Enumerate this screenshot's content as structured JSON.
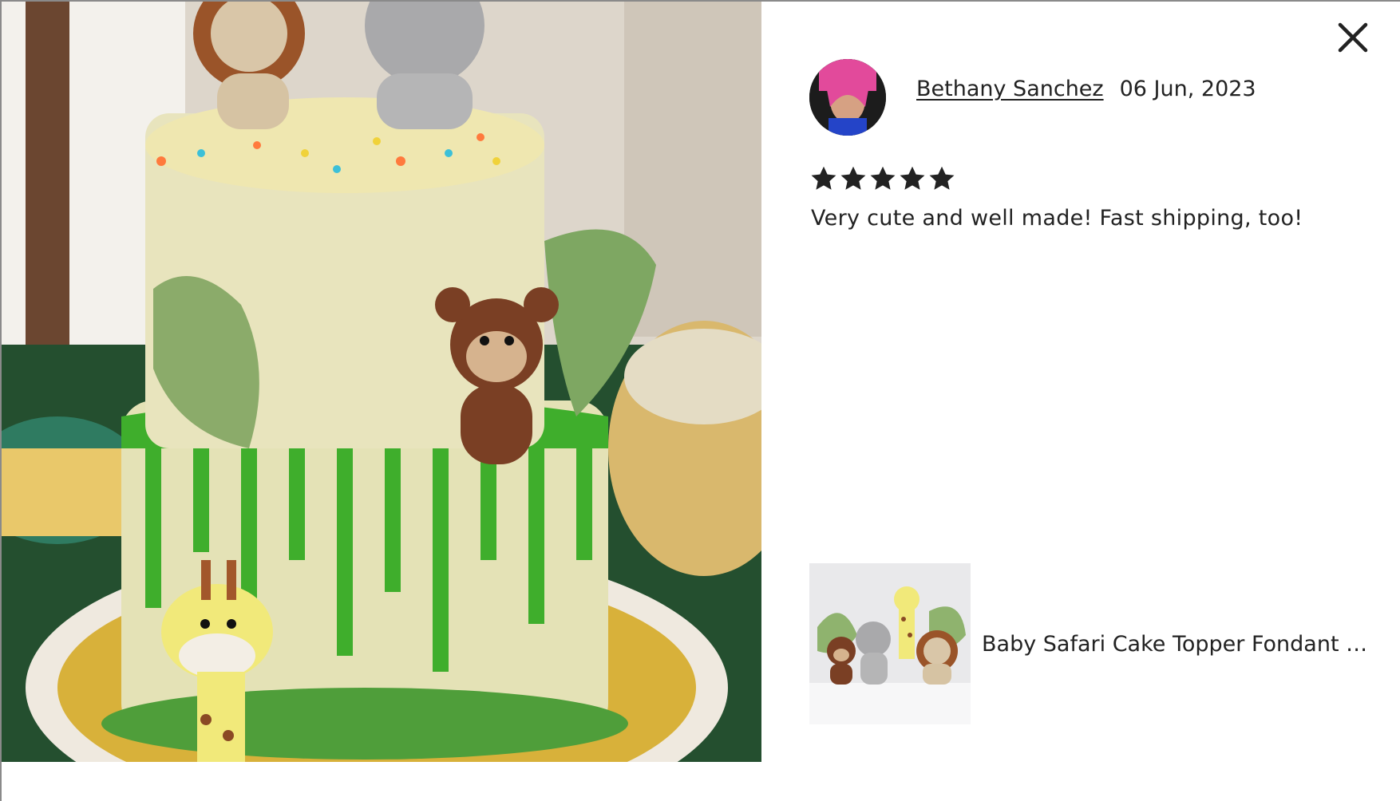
{
  "review": {
    "reviewer_name": "Bethany Sanchez",
    "date": "06 Jun, 2023",
    "rating": 5,
    "rating_max": 5,
    "text": "Very cute and well made! Fast shipping, too!"
  },
  "product": {
    "title": "Baby Safari Cake Topper Fondant w..."
  },
  "icons": {
    "close": "close-icon",
    "star": "star-icon"
  },
  "colors": {
    "text": "#222222",
    "star": "#222222"
  }
}
